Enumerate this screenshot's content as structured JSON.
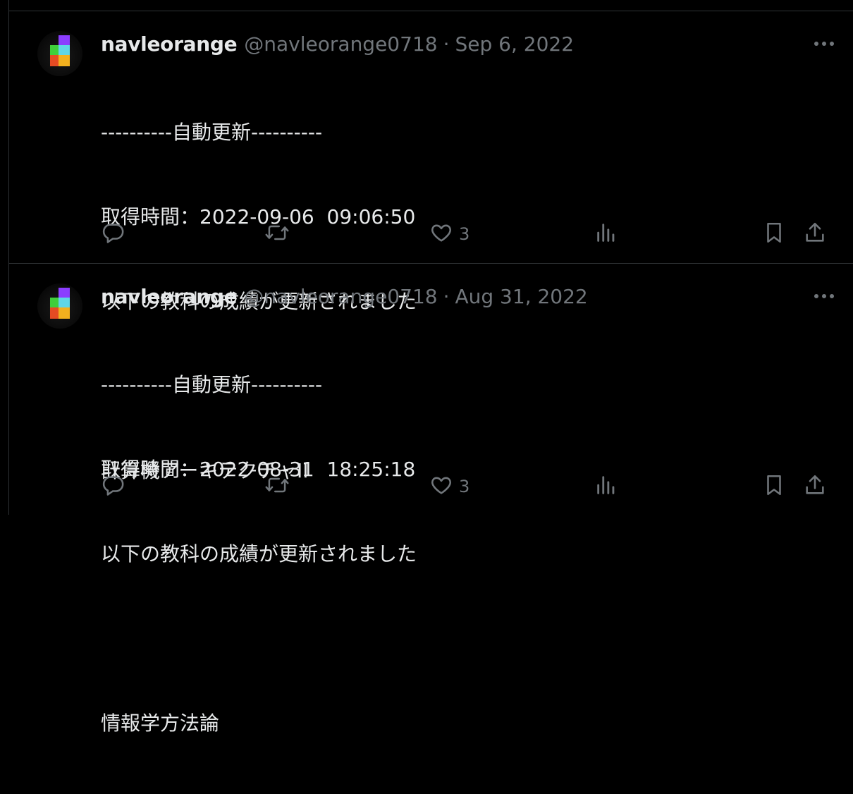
{
  "tweets": [
    {
      "name": "navleorange",
      "handle": "@navleorange0718",
      "separator": "·",
      "date": "Sep 6, 2022",
      "lines": [
        "----------自動更新----------",
        "取得時間：2022-09-06  09:06:50",
        "以下の教科の成績が更新されました",
        "",
        "計算機アーキテクチャII"
      ],
      "likes": "3"
    },
    {
      "name": "navleorange",
      "handle": "@navleorange0718",
      "separator": "·",
      "date": "Aug 31, 2022",
      "lines": [
        "----------自動更新----------",
        "取得時間：2022-08-31  18:25:18",
        "以下の教科の成績が更新されました",
        "",
        "情報学方法論"
      ],
      "likes": "3"
    }
  ],
  "icons": {
    "more": "more-icon",
    "reply": "reply-icon",
    "retweet": "retweet-icon",
    "like": "heart-icon",
    "views": "views-icon",
    "bookmark": "bookmark-icon",
    "share": "share-icon"
  },
  "colors": {
    "background": "#000000",
    "text": "#e7e9ea",
    "secondary": "#71767b",
    "border": "#2f3336"
  }
}
